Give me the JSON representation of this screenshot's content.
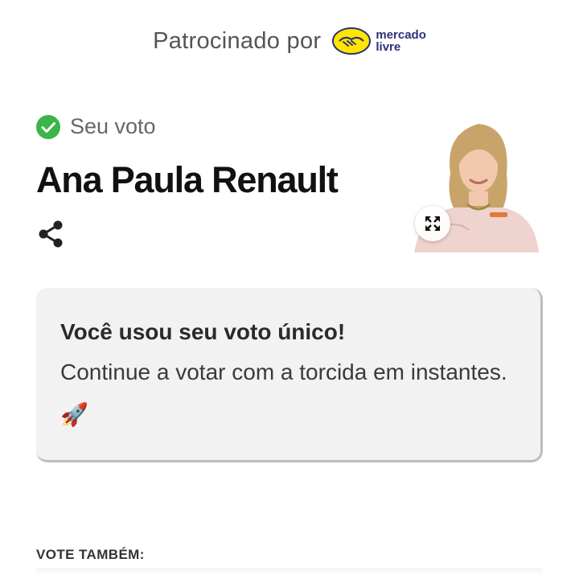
{
  "sponsor": {
    "label": "Patrocinado por",
    "logo_word1": "mercado",
    "logo_word2": "livre"
  },
  "vote": {
    "status_label": "Seu voto",
    "candidate_name": "Ana Paula Renault"
  },
  "notice": {
    "title": "Você usou seu voto único!",
    "body": "Continue a votar com a torcida em instantes. 🚀"
  },
  "section": {
    "vote_also_label": "VOTE TAMBÉM:"
  },
  "icons": {
    "status": "check-circle-icon",
    "share": "share-icon",
    "expand": "expand-icon"
  },
  "colors": {
    "check_green": "#3bb54a",
    "ml_yellow": "#ffe600",
    "ml_blue": "#2d3277"
  }
}
